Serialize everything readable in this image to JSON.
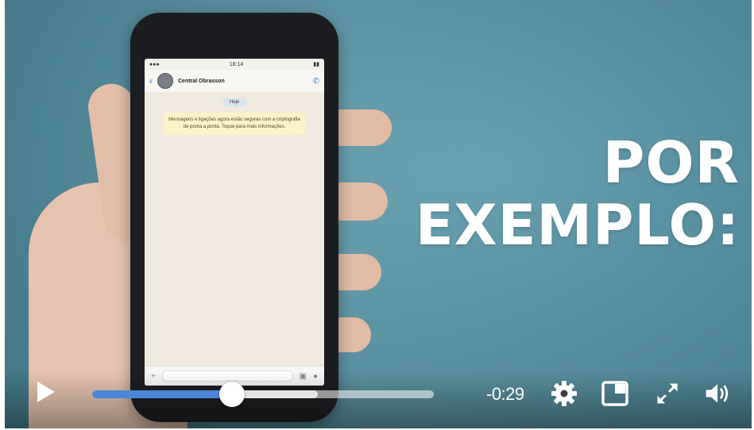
{
  "video": {
    "overlay": {
      "line1": "POR",
      "line2": "EXEMPLO:"
    },
    "phone_screen": {
      "chat_title": "Central Obrasson",
      "date_chip": "Hoje",
      "notice": "Mensagens e ligações agora estão seguras com a criptografia de ponta a ponta. Toque para mais informações."
    }
  },
  "controls": {
    "time_remaining": "-0:29",
    "progress_fraction": 0.41,
    "buffered_fraction": 0.66,
    "accent_color": "#4b86d9",
    "icons": [
      "play-icon",
      "gear-icon",
      "picture-in-picture-icon",
      "fullscreen-icon",
      "volume-icon"
    ]
  }
}
